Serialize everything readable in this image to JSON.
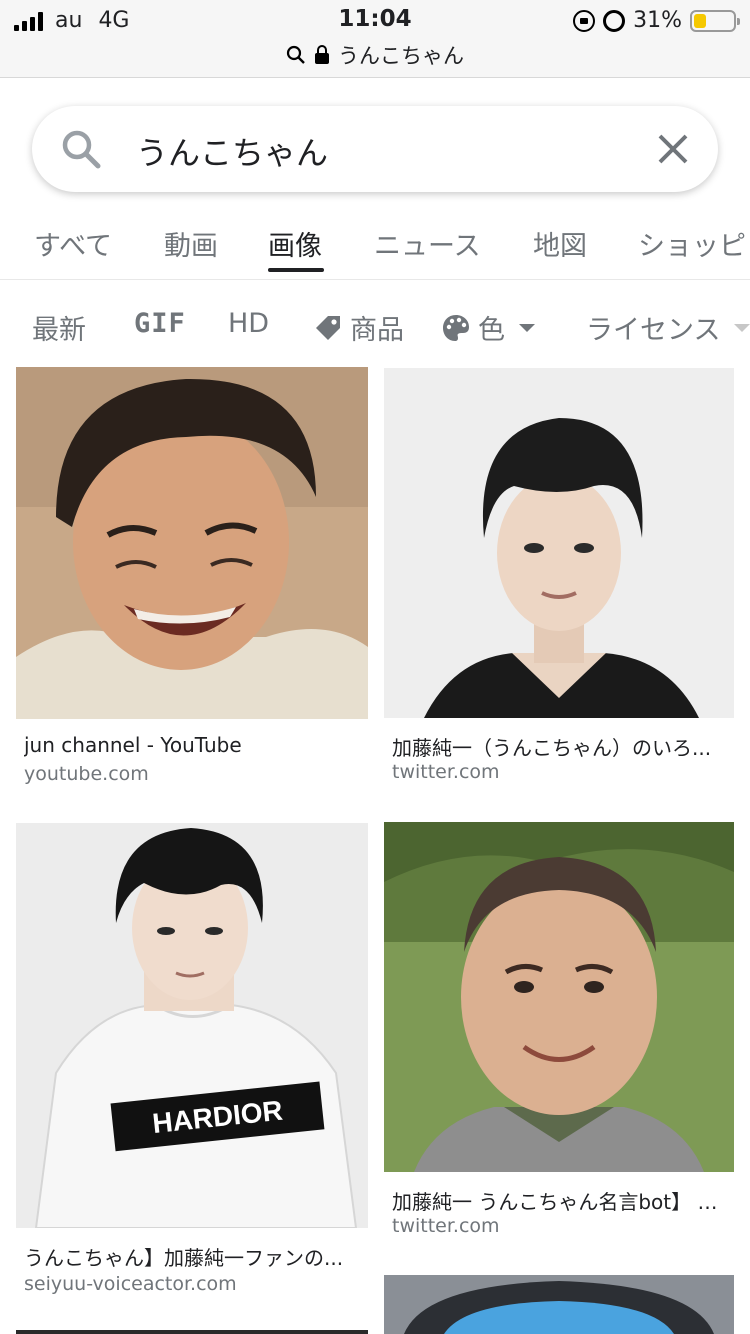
{
  "status": {
    "carrier": "au",
    "network": "4G",
    "time": "11:04",
    "battery": "31%",
    "battery_level": 0.31
  },
  "address_bar": {
    "text": "うんこちゃん"
  },
  "search": {
    "query": "うんこちゃん"
  },
  "tabs": [
    {
      "label": "すべて",
      "active": false
    },
    {
      "label": "動画",
      "active": false
    },
    {
      "label": "画像",
      "active": true
    },
    {
      "label": "ニュース",
      "active": false
    },
    {
      "label": "地図",
      "active": false
    },
    {
      "label": "ショッピ",
      "active": false
    }
  ],
  "filters": {
    "latest": "最新",
    "gif": "GIF",
    "hd": "HD",
    "product": "商品",
    "color": "色",
    "license": "ライセンス"
  },
  "results": [
    {
      "title": "jun channel - YouTube",
      "source": "youtube.com"
    },
    {
      "title": "加藤純一（うんこちゃん）のいろ...",
      "source": "twitter.com"
    },
    {
      "title": "うんこちゃん】加藤純一ファンの...",
      "source": "seiyuu-voiceactor.com",
      "shirt_text": "HARDIOR"
    },
    {
      "title": "加藤純一 うんこちゃん名言bot】 (...",
      "source": "twitter.com"
    }
  ],
  "icons": [
    "signal-icon",
    "lock-icon",
    "search-icon",
    "close-icon",
    "tag-icon",
    "palette-icon",
    "alarm-icon",
    "battery-icon"
  ],
  "colors": {
    "accent": "#202124",
    "muted": "#70757a",
    "battery": "#f5c800"
  }
}
